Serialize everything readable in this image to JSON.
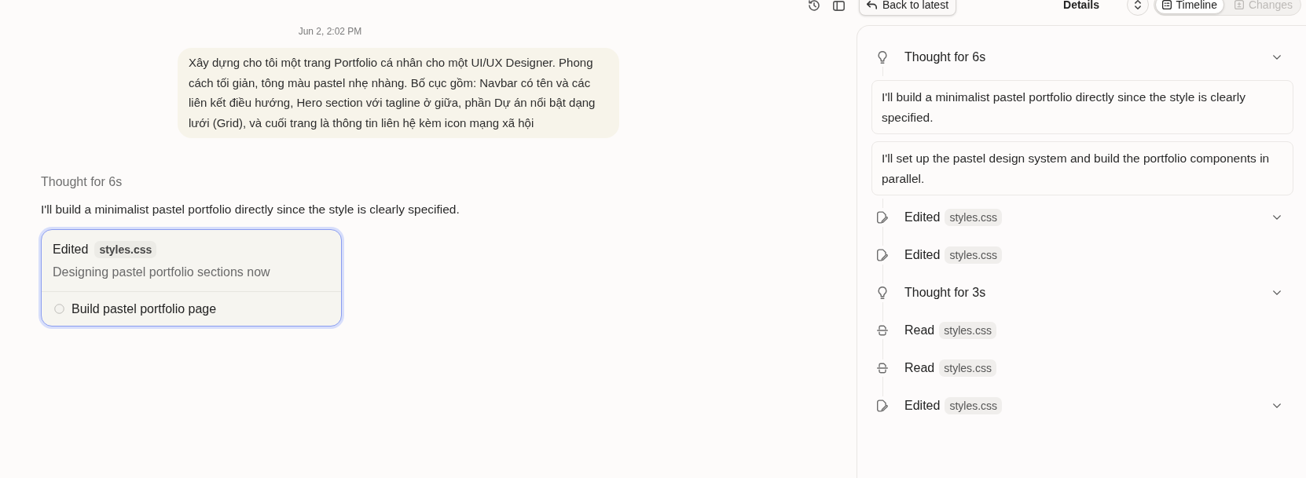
{
  "toolbar": {
    "back_button": {
      "label": "Back to latest"
    },
    "title": "Details",
    "tabs": [
      {
        "label": "Timeline",
        "selected": true,
        "disabled": false
      },
      {
        "label": "Changes",
        "selected": false,
        "disabled": true
      }
    ]
  },
  "conversation": {
    "timestamp": "Jun 2, 2:02 PM",
    "user_message": "Xây dựng cho tôi một trang Portfolio cá nhân cho một UI/UX Designer. Phong cách tối giản, tông màu pastel nhẹ nhàng. Bố cục gồm: Navbar có tên và các liên kết điều hướng, Hero section với tagline ở giữa, phần Dự án nổi bật dạng lưới (Grid), và cuối trang là thông tin liên hệ kèm icon mạng xã hội",
    "thought_label": "Thought for 6s",
    "reply": "I'll build a minimalist pastel portfolio directly since the style is clearly specified.",
    "task_card": {
      "action": "Edited",
      "file": "styles.css",
      "status": "Designing pastel portfolio sections now",
      "todos": [
        {
          "label": "Build pastel portfolio page",
          "checked": false
        }
      ]
    }
  },
  "timeline": [
    {
      "kind": "thought",
      "label": "Thought for 6s",
      "expandable": true,
      "notes": [
        "I'll build a minimalist pastel portfolio directly since the style is clearly specified.",
        "I'll set up the pastel design system and build the portfolio components in parallel."
      ]
    },
    {
      "kind": "edit",
      "label": "Edited",
      "file": "styles.css",
      "expandable": true
    },
    {
      "kind": "edit",
      "label": "Edited",
      "file": "styles.css",
      "expandable": false
    },
    {
      "kind": "thought",
      "label": "Thought for 3s",
      "expandable": true
    },
    {
      "kind": "read",
      "label": "Read",
      "file": "styles.css",
      "expandable": false
    },
    {
      "kind": "read",
      "label": "Read",
      "file": "styles.css",
      "expandable": false
    },
    {
      "kind": "edit",
      "label": "Edited",
      "file": "styles.css",
      "expandable": true
    }
  ]
}
